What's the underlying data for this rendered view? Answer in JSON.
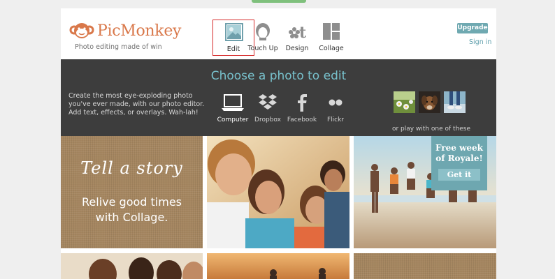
{
  "brand": {
    "name": "PicMonkey",
    "tagline": "Photo editing made of win",
    "logo_color": "#d9784a"
  },
  "toolbar": {
    "items": [
      {
        "label": "Edit",
        "icon": "image-icon",
        "selected": true
      },
      {
        "label": "Touch Up",
        "icon": "face-icon",
        "selected": false
      },
      {
        "label": "Design",
        "icon": "design-icon",
        "selected": false
      },
      {
        "label": "Collage",
        "icon": "collage-icon",
        "selected": false
      }
    ]
  },
  "account": {
    "upgrade_label": "Upgrade",
    "signin_label": "Sign in"
  },
  "band": {
    "title": "Choose a photo to edit",
    "description": "Create the most eye-exploding photo you've ever made, with our photo editor. Add text, effects, or overlays. Wah-lah!",
    "sources": [
      {
        "label": "Computer",
        "icon": "laptop-icon"
      },
      {
        "label": "Dropbox",
        "icon": "dropbox-icon"
      },
      {
        "label": "Facebook",
        "icon": "facebook-icon"
      },
      {
        "label": "Flickr",
        "icon": "flickr-icon"
      }
    ],
    "samples_label": "or play with one of these"
  },
  "tiles": {
    "collage": {
      "script": "Tell a story",
      "line1": "Relive good times",
      "line2": "with Collage."
    },
    "royale": {
      "line1": "Free week",
      "line2": "of Royale!",
      "button": "Get it"
    }
  },
  "colors": {
    "accent": "#78c1cc",
    "upgrade_bg": "#6fa9b1",
    "band_bg": "#3d3d3d",
    "selected_border": "#d62b2b"
  }
}
